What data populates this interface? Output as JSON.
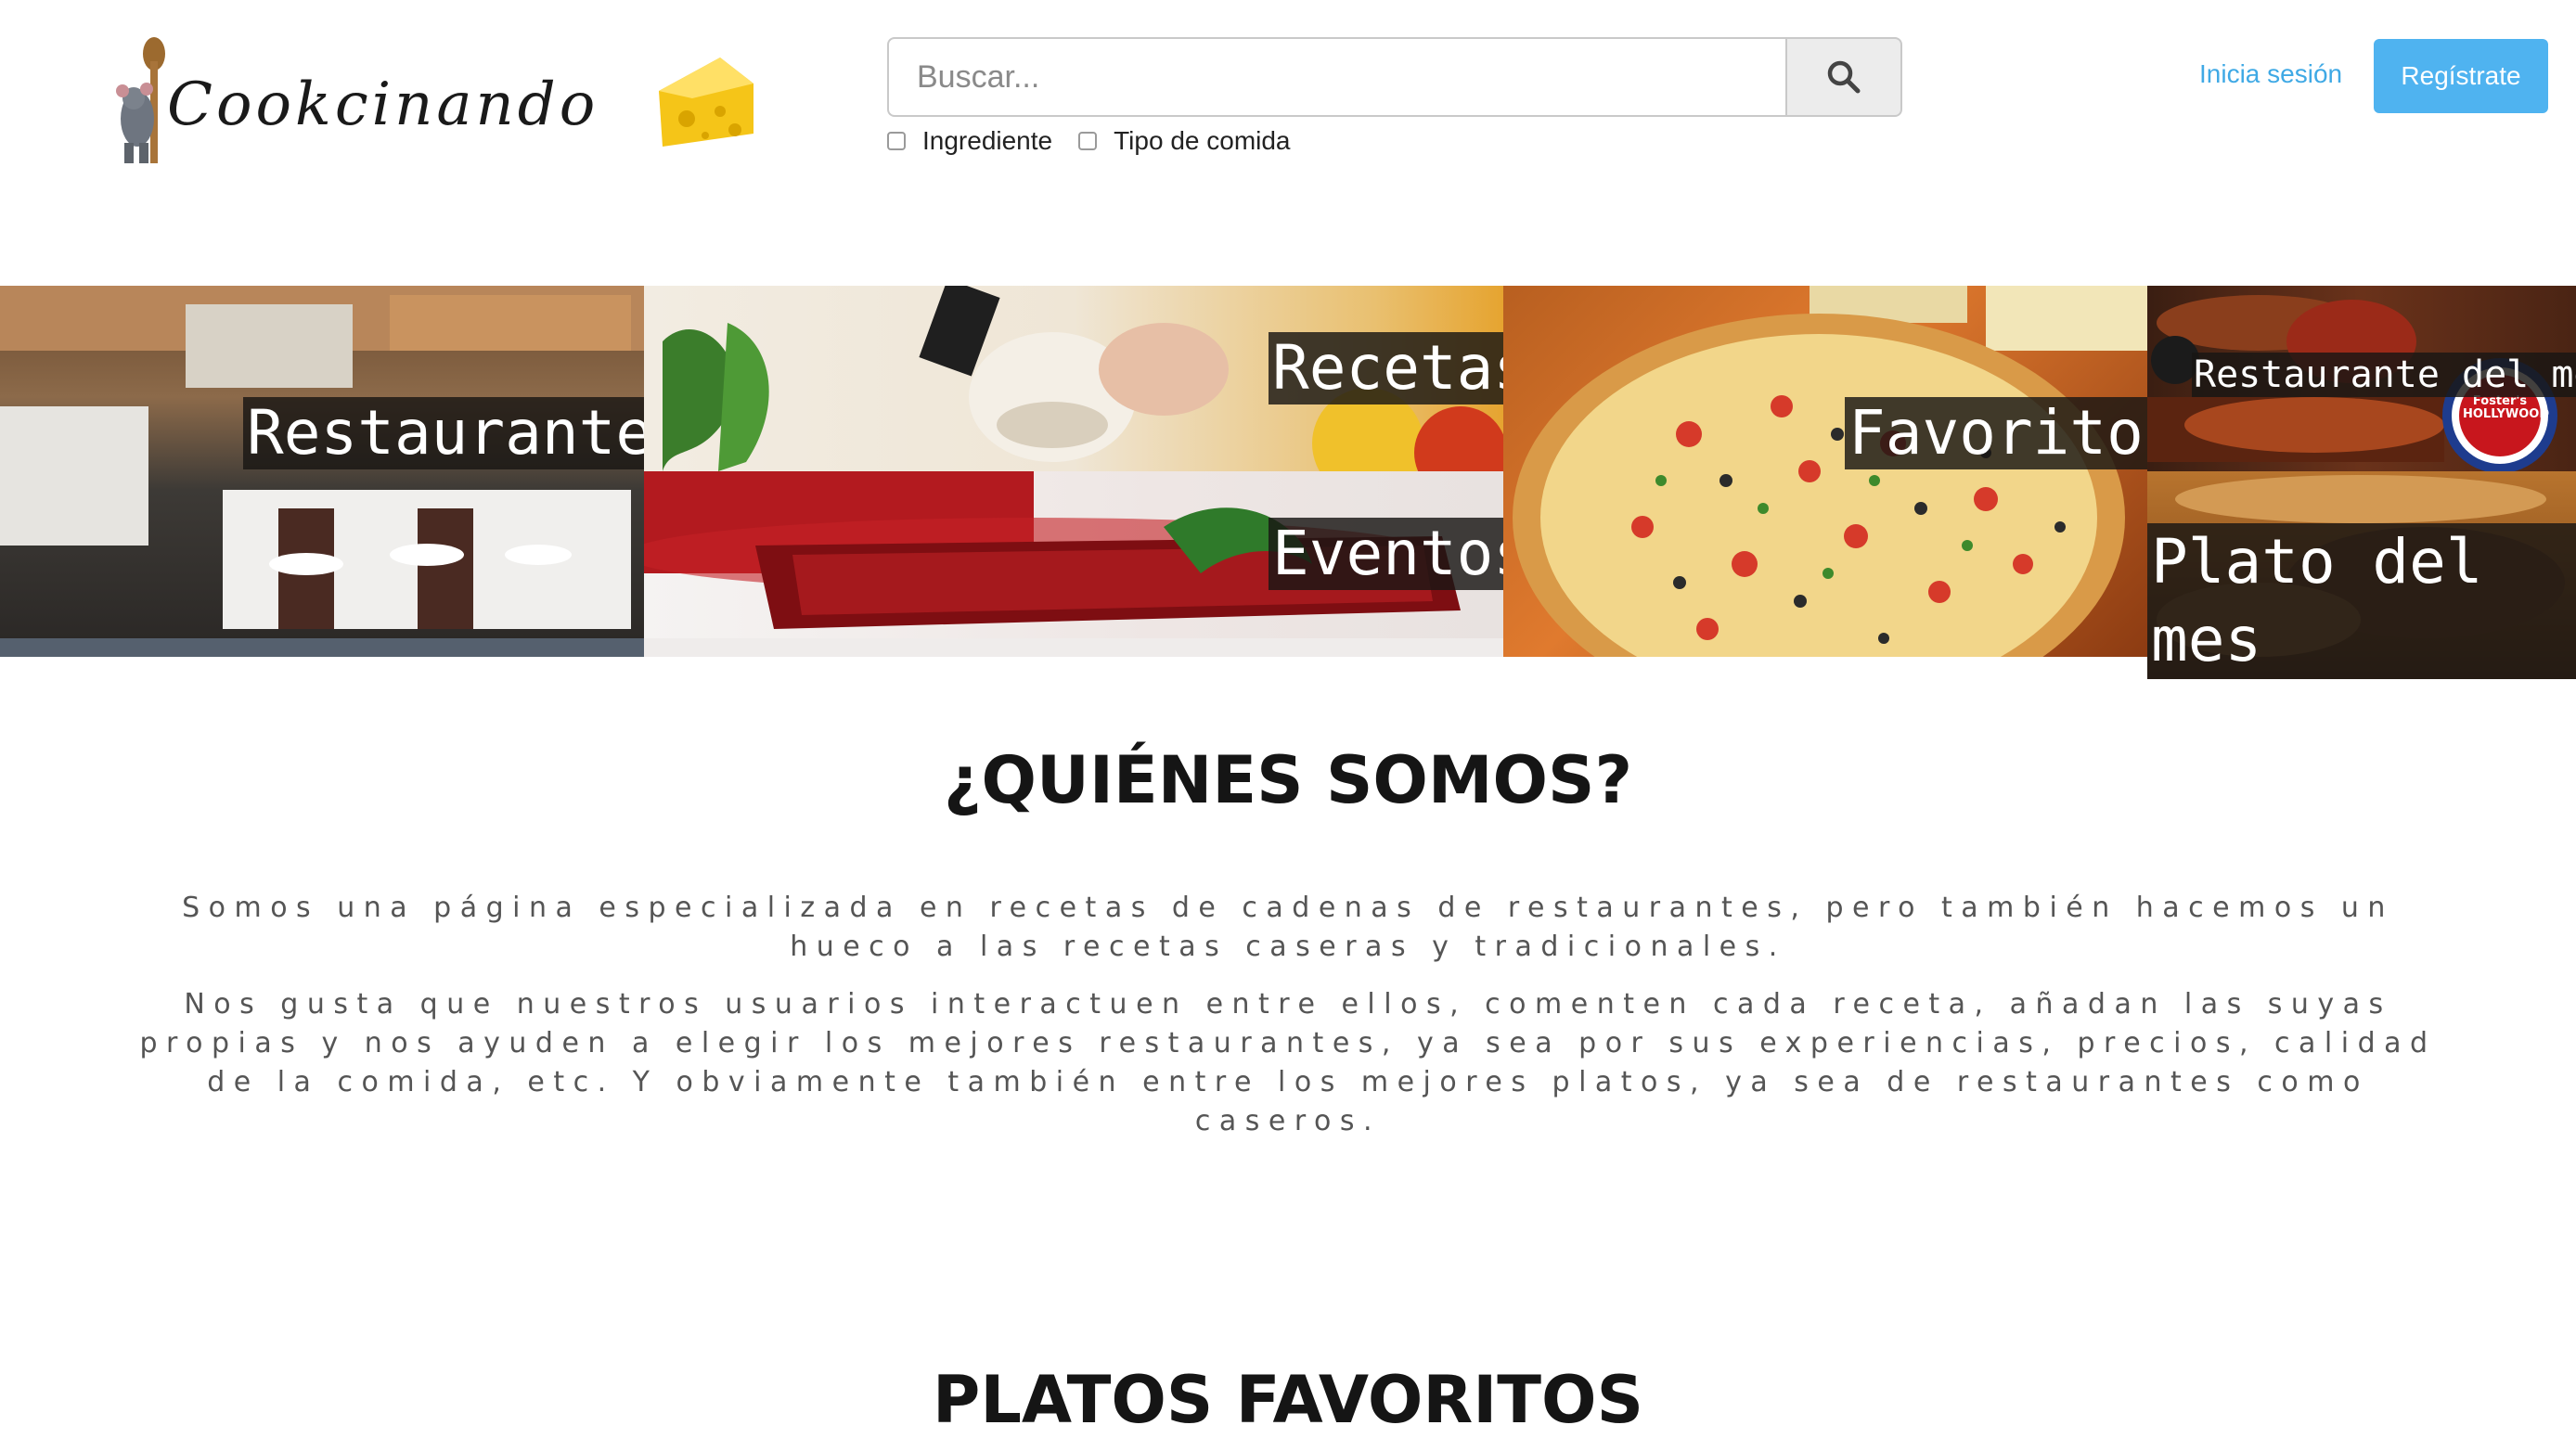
{
  "header": {
    "logo_text": "Cookcinando",
    "search": {
      "placeholder": "Buscar..."
    },
    "filters": [
      {
        "label": "Ingrediente",
        "checked": false
      },
      {
        "label": "Tipo de comida",
        "checked": false
      }
    ],
    "login_label": "Inicia sesión",
    "register_label": "Regístrate"
  },
  "banner": {
    "restaurantes": "Restaurantes",
    "recetas": "Recetas",
    "eventos": "Eventos",
    "favoritos": "Favoritos",
    "restaurante_mes": "Restaurante del mes",
    "restaurante_mes_logo": "Foster's HOLLYWOOD",
    "plato_mes": "Plato del mes"
  },
  "about": {
    "title": "¿QUIÉNES SOMOS?",
    "paragraphs": [
      "Somos una página especializada en recetas de cadenas de restaurantes, pero también hacemos un hueco a las recetas caseras y tradicionales.",
      "Nos gusta que nuestros usuarios interactuen entre ellos, comenten cada receta, añadan las suyas propias y nos ayuden a elegir los mejores restaurantes, ya sea por sus experiencias, precios, calidad de la comida, etc. Y obviamente también entre los mejores platos, ya sea de restaurantes como caseros."
    ]
  },
  "next_section": {
    "title": "PLATOS FAVORITOS"
  },
  "colors": {
    "link": "#3fa9e5",
    "button": "#4fb3f0",
    "label_bg": "#191614"
  }
}
